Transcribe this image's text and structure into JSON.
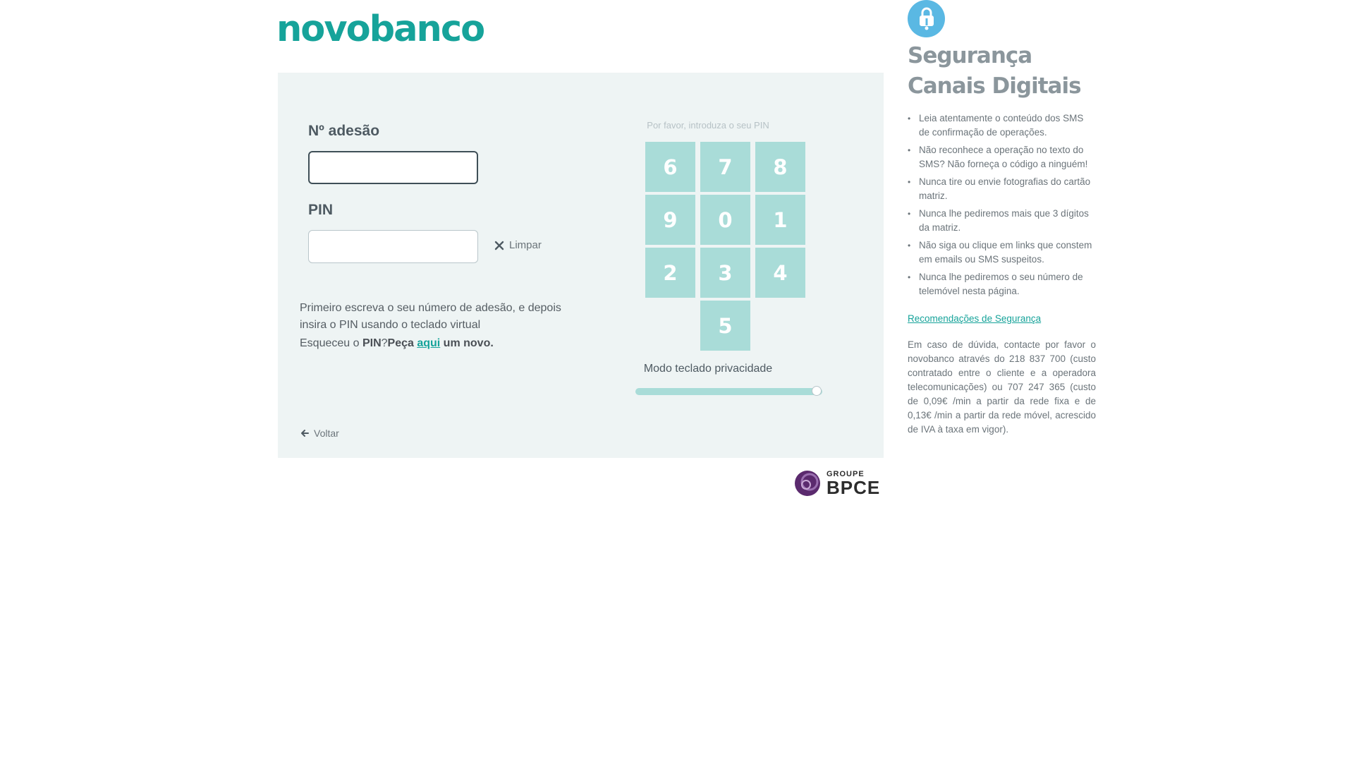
{
  "brand": {
    "logo": "novobanco",
    "accent": "#16a39a"
  },
  "form": {
    "adesao_label": "Nº adesão",
    "adesao_value": "",
    "pin_label": "PIN",
    "pin_value": "",
    "clear_label": "Limpar",
    "help_text": "Primeiro escreva o seu número de adesão, e depois insira o PIN usando o teclado virtual",
    "forgot_prefix": "Esqueceu o ",
    "forgot_pin": "PIN",
    "forgot_q": "?",
    "forgot_ask": "Peça ",
    "forgot_link": "aqui",
    "forgot_suffix": " um novo.",
    "back_label": "Voltar"
  },
  "keypad": {
    "prompt": "Por favor, introduza o seu PIN",
    "keys": [
      "6",
      "7",
      "8",
      "9",
      "0",
      "1",
      "2",
      "3",
      "4",
      "5"
    ],
    "mode_label": "Modo teclado privacidade",
    "privacy_slider_value": 0.97,
    "key_color": "#a9dcd8"
  },
  "footer_brand": {
    "small": "GROUPE",
    "big": "BPCE"
  },
  "side": {
    "icon": "lock-icon",
    "title": "Segurança Canais Digitais",
    "tips": [
      "Leia atentamente o conteúdo dos SMS de confirmação de operações.",
      "Não reconhece a operação no texto do SMS? Não forneça o código a ninguém!",
      "Nunca tire ou envie fotografias do cartão matriz.",
      "Nunca lhe pediremos mais que 3 dígitos da matriz.",
      "Não siga ou clique em links que constem em emails ou SMS suspeitos.",
      "Nunca lhe pediremos o seu número de telemóvel nesta página."
    ],
    "recommendations_link": "Recomendações de Segurança",
    "contact_text": "Em caso de dúvida, contacte por favor o novobanco através do 218 837 700 (custo contratado entre o cliente e a operadora telecomunicações) ou 707 247 365 (custo de 0,09€ /min a partir da rede fixa e de 0,13€ /min a partir da rede móvel, acrescido de IVA à taxa em vigor)."
  }
}
